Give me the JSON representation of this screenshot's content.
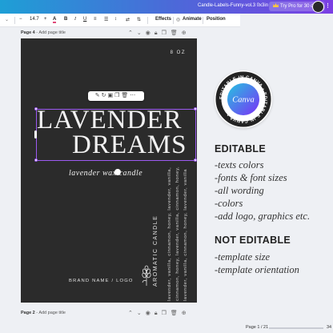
{
  "app": {
    "doc_title": "Candle-Labels-Funny-vol.3 0x3in",
    "pro_button": "Try Pro for 30 days",
    "menu_icon": "more-dots-icon"
  },
  "toolbar": {
    "font_size": "14.7",
    "plus": "+",
    "minus": "−",
    "text_color_icon": "A",
    "bold_icon": "B",
    "italic_icon": "I",
    "underline_icon": "U",
    "effects_label": "Effects",
    "animate_label": "Animate",
    "position_label": "Position"
  },
  "pages": {
    "page4_label": "Page 4",
    "page4_placeholder": "Add page title",
    "page2_label": "Page 2",
    "page2_placeholder": "Add page title",
    "dash": " - "
  },
  "label": {
    "size": "8 OZ",
    "title_line1": "LAVENDER",
    "title_line2": "DREAMS",
    "subtitle": "lavender wax candle",
    "vertical_title": "AROMATIC CANDLE",
    "vertical_lines": [
      "lavender, vanilla, cinnamon, honey, lavender, vanilla,",
      "cinnamon, honey, lavender, vanilla, cinnamon, honey,",
      "lavender, vanilla, cinnamon, honey, lavender, vanilla"
    ],
    "brand": "BRAND NAME / LOGO"
  },
  "badge": {
    "canva_word": "Canva",
    "ring_text": "EDITABLE IN CANVA • EDITABLE IN CANVA •",
    "colors": {
      "ring": "#232323",
      "center_start": "#25c4e0",
      "center_end": "#7b2ff7"
    }
  },
  "right_panel": {
    "editable_heading": "EDITABLE",
    "editable_items": [
      "-texts colors",
      "-fonts & font sizes",
      "-all wording",
      "-colors",
      "-add logo, graphics etc."
    ],
    "not_editable_heading": "NOT EDITABLE",
    "not_editable_items": [
      "-template size",
      "-template orientation"
    ]
  },
  "footer": {
    "page_indicator": "Page 1 / 21",
    "zoom": "34"
  },
  "colors": {
    "accent_purple": "#9c5af2",
    "canvas_bg": "#2b2b2b"
  }
}
